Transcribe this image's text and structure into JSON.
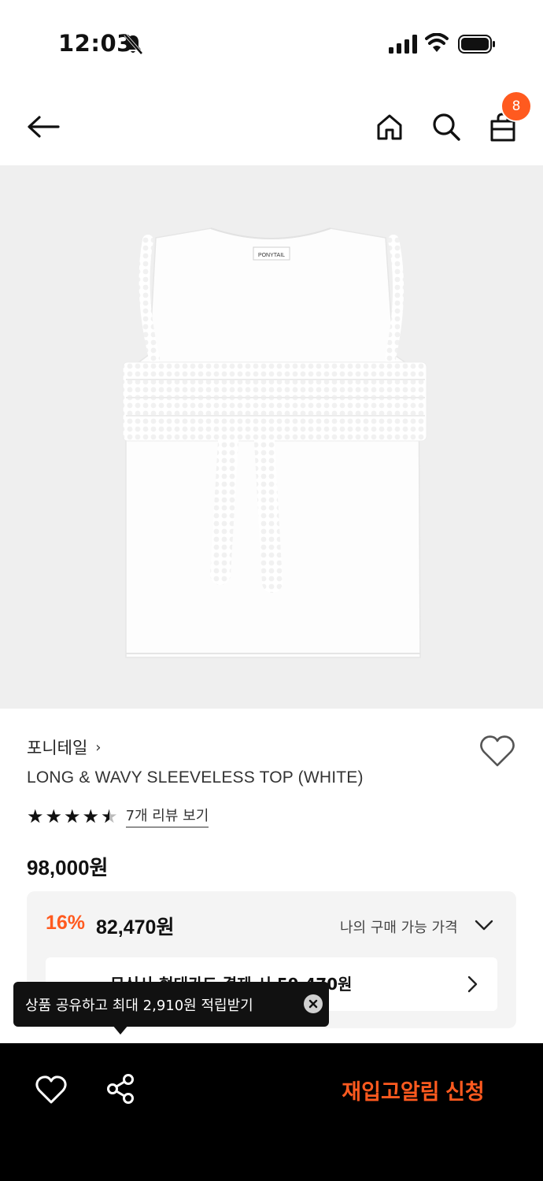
{
  "status_bar": {
    "time": "12:03"
  },
  "nav": {
    "cart_count": "8"
  },
  "product": {
    "brand": "포니테일",
    "title": "LONG & WAVY SLEEVELESS TOP (WHITE)",
    "rating": 4.5,
    "review_link": "7개 리뷰 보기",
    "original_price": "98,000원",
    "tag_text": "PONYTAIL"
  },
  "price_box": {
    "discount_rate": "16%",
    "discount_price": "82,470원",
    "my_price_label": "나의 구매 가능 가격",
    "card_offer": "무신사 현대카드 결제 시 59,470원"
  },
  "tooltip": {
    "text": "상품 공유하고 최대 2,910원 적립받기"
  },
  "bottom_bar": {
    "restock_label": "재입고알림 신청"
  },
  "colors": {
    "accent": "#ff5a1f",
    "background_image": "#efefef",
    "bottom_bar": "#000000"
  }
}
